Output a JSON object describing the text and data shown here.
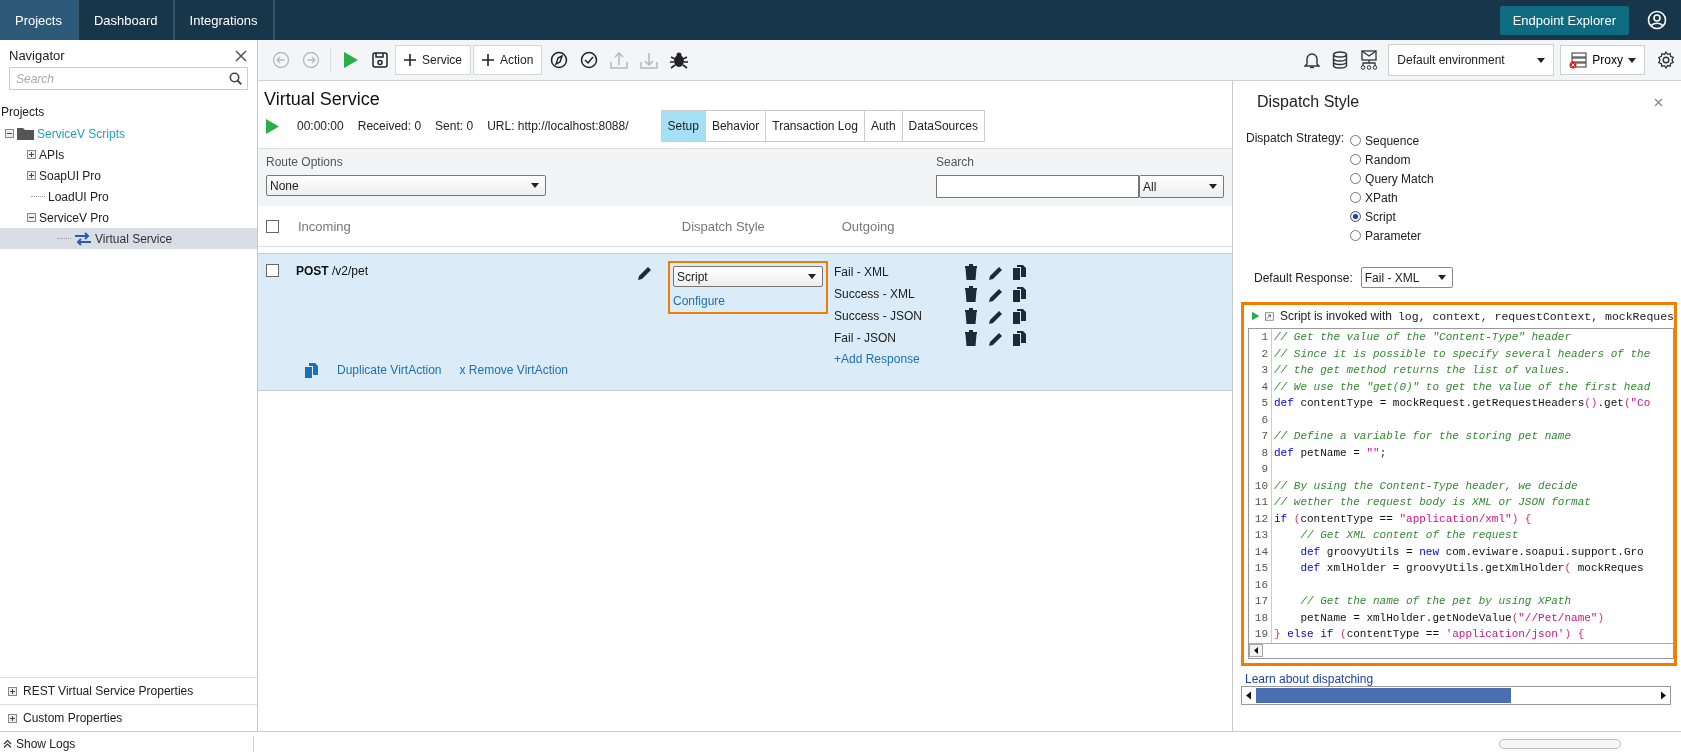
{
  "top_bar": {
    "tabs": [
      {
        "label": "Projects",
        "selected": true
      },
      {
        "label": "Dashboard",
        "selected": false
      },
      {
        "label": "Integrations",
        "selected": false
      }
    ],
    "endpoint_button": "Endpoint Explorer"
  },
  "navigator": {
    "title": "Navigator",
    "search": {
      "placeholder": "Search"
    },
    "root_label": "Projects",
    "tree": [
      {
        "label": "ServiceV Scripts",
        "kind": "folder",
        "expanded": true,
        "selected": false,
        "children": [
          {
            "label": "APIs",
            "expanded": false,
            "selected": false
          },
          {
            "label": "SoapUI Pro",
            "expanded": false,
            "selected": false
          },
          {
            "label": "LoadUI Pro",
            "selected": false
          },
          {
            "label": "ServiceV Pro",
            "expanded": true,
            "selected": false,
            "children": [
              {
                "label": "Virtual Service",
                "kind": "service",
                "selected": true
              }
            ]
          }
        ]
      }
    ],
    "bottom_panels": [
      "REST Virtual Service Properties",
      "Custom Properties"
    ]
  },
  "toolbar": {
    "items": [
      {
        "kind": "back",
        "disabled": true
      },
      {
        "kind": "forward",
        "disabled": true
      },
      {
        "kind": "run",
        "disabled": false
      },
      {
        "kind": "save",
        "disabled": false
      },
      {
        "kind": "text",
        "label": "Service",
        "disabled": false
      },
      {
        "kind": "text",
        "label": "Action",
        "disabled": false
      },
      {
        "kind": "compass",
        "disabled": false
      },
      {
        "kind": "check",
        "disabled": false
      },
      {
        "kind": "upload",
        "disabled": true
      },
      {
        "kind": "download",
        "disabled": true
      },
      {
        "kind": "bug",
        "disabled": false
      }
    ],
    "environment": "Default environment",
    "proxy": "Proxy"
  },
  "service": {
    "title": "Virtual Service",
    "elapsed": "00:00:00",
    "received": "Received: 0",
    "sent": "Sent: 0",
    "url": "URL: http://localhost:8088/",
    "tabs": [
      {
        "label": "Setup",
        "selected": true
      },
      {
        "label": "Behavior",
        "selected": false
      },
      {
        "label": "Transaction Log",
        "selected": false
      },
      {
        "label": "Auth",
        "selected": false
      },
      {
        "label": "DataSources",
        "selected": false
      }
    ],
    "route_options": {
      "label": "Route Options",
      "value": "None"
    },
    "search": {
      "label": "Search"
    },
    "filter": "All",
    "columns": [
      "Incoming",
      "Dispatch Style",
      "Outgoing"
    ],
    "select_all_checked": false,
    "actions": [
      {
        "request": "**POST** /v2/pet",
        "checked": false,
        "dispatch": "Script",
        "configure": "Configure",
        "highlighted": true,
        "responses": [
          "Fail - XML",
          "Success - XML",
          "Success - JSON",
          "Fail - JSON"
        ],
        "add_response": "+Add Response",
        "duplicate": "Duplicate VirtAction",
        "remove": "x Remove VirtAction"
      }
    ]
  },
  "dispatch_panel": {
    "title": "Dispatch Style",
    "strategy_label": "Dispatch Strategy:",
    "strategies": [
      {
        "label": "Sequence",
        "selected": false
      },
      {
        "label": "Random",
        "selected": false
      },
      {
        "label": "Query Match",
        "selected": false
      },
      {
        "label": "XPath",
        "selected": false
      },
      {
        "label": "Script",
        "selected": true
      },
      {
        "label": "Parameter",
        "selected": false
      }
    ],
    "default_response_label": "Default Response:",
    "default_response": "Fail - XML",
    "script": {
      "highlighted": true,
      "intro": "Script is invoked with",
      "variables": "log, context, requestContext, mockReques",
      "lines": [
        {
          "number": "1",
          "tokens": [
            {
              "kind": "comment",
              "text": "// Get the value of the \"Content-Type\" header"
            }
          ]
        },
        {
          "number": "2",
          "tokens": [
            {
              "kind": "comment",
              "text": "// Since it is possible to specify several headers of the"
            }
          ]
        },
        {
          "number": "3",
          "tokens": [
            {
              "kind": "comment",
              "text": "// the get method returns the list of values."
            }
          ]
        },
        {
          "number": "4",
          "tokens": [
            {
              "kind": "comment",
              "text": "// We use the \"get(0)\" to get the value of the first head"
            }
          ]
        },
        {
          "number": "5",
          "tokens": [
            {
              "kind": "keyword",
              "text": "def"
            },
            {
              "kind": "plain",
              "text": " contentType = mockRequest.getRequestHeaders"
            },
            {
              "kind": "bracket",
              "text": "()"
            },
            {
              "kind": "plain",
              "text": ".get"
            },
            {
              "kind": "bracket",
              "text": "("
            },
            {
              "kind": "string",
              "text": "\"Co"
            }
          ]
        },
        {
          "number": "6"
        },
        {
          "number": "7",
          "tokens": [
            {
              "kind": "comment",
              "text": "// Define a variable for the storing pet name"
            }
          ]
        },
        {
          "number": "8",
          "tokens": [
            {
              "kind": "keyword",
              "text": "def"
            },
            {
              "kind": "plain",
              "text": " petName = "
            },
            {
              "kind": "string",
              "text": "\"\""
            },
            {
              "kind": "plain",
              "text": ";"
            }
          ]
        },
        {
          "number": "9"
        },
        {
          "number": "10",
          "tokens": [
            {
              "kind": "comment",
              "text": "// By using the Content-Type header, we decide"
            }
          ]
        },
        {
          "number": "11",
          "tokens": [
            {
              "kind": "comment",
              "text": "// wether the request body is XML or JSON format"
            }
          ]
        },
        {
          "number": "12",
          "tokens": [
            {
              "kind": "keyword",
              "text": "if"
            },
            {
              "kind": "bracket",
              "text": " ("
            },
            {
              "kind": "plain",
              "text": "contentType == "
            },
            {
              "kind": "string",
              "text": "\"application/xml\""
            },
            {
              "kind": "bracket",
              "text": ") {"
            }
          ]
        },
        {
          "number": "13",
          "tokens": [
            {
              "kind": "comment",
              "text": "    // Get XML content of the request"
            }
          ]
        },
        {
          "number": "14",
          "tokens": [
            {
              "kind": "keyword",
              "text": "    def"
            },
            {
              "kind": "plain",
              "text": " groovyUtils = "
            },
            {
              "kind": "keyword",
              "text": "new"
            },
            {
              "kind": "plain",
              "text": " com.eviware.soapui.support.Gro"
            }
          ]
        },
        {
          "number": "15",
          "tokens": [
            {
              "kind": "keyword",
              "text": "    def"
            },
            {
              "kind": "plain",
              "text": " xmlHolder = groovyUtils.getXmlHolder"
            },
            {
              "kind": "bracket",
              "text": "("
            },
            {
              "kind": "plain",
              "text": " mockReques"
            }
          ]
        },
        {
          "number": "16"
        },
        {
          "number": "17",
          "tokens": [
            {
              "kind": "comment",
              "text": "    // Get the name of the pet by using XPath"
            }
          ]
        },
        {
          "number": "18",
          "tokens": [
            {
              "kind": "plain",
              "text": "    petName = xmlHolder.getNodeValue"
            },
            {
              "kind": "bracket",
              "text": "("
            },
            {
              "kind": "string",
              "text": "\"//Pet/name\""
            },
            {
              "kind": "bracket",
              "text": ")"
            }
          ]
        },
        {
          "number": "19",
          "tokens": [
            {
              "kind": "bracket",
              "text": "}"
            },
            {
              "kind": "keyword",
              "text": " else if"
            },
            {
              "kind": "bracket",
              "text": " ("
            },
            {
              "kind": "plain",
              "text": "contentType == "
            },
            {
              "kind": "string",
              "text": "'application/json'"
            },
            {
              "kind": "bracket",
              "text": ") {"
            }
          ]
        }
      ]
    },
    "learn_link": "Learn about dispatching"
  },
  "status_bar": {
    "show_logs": "Show Logs"
  }
}
